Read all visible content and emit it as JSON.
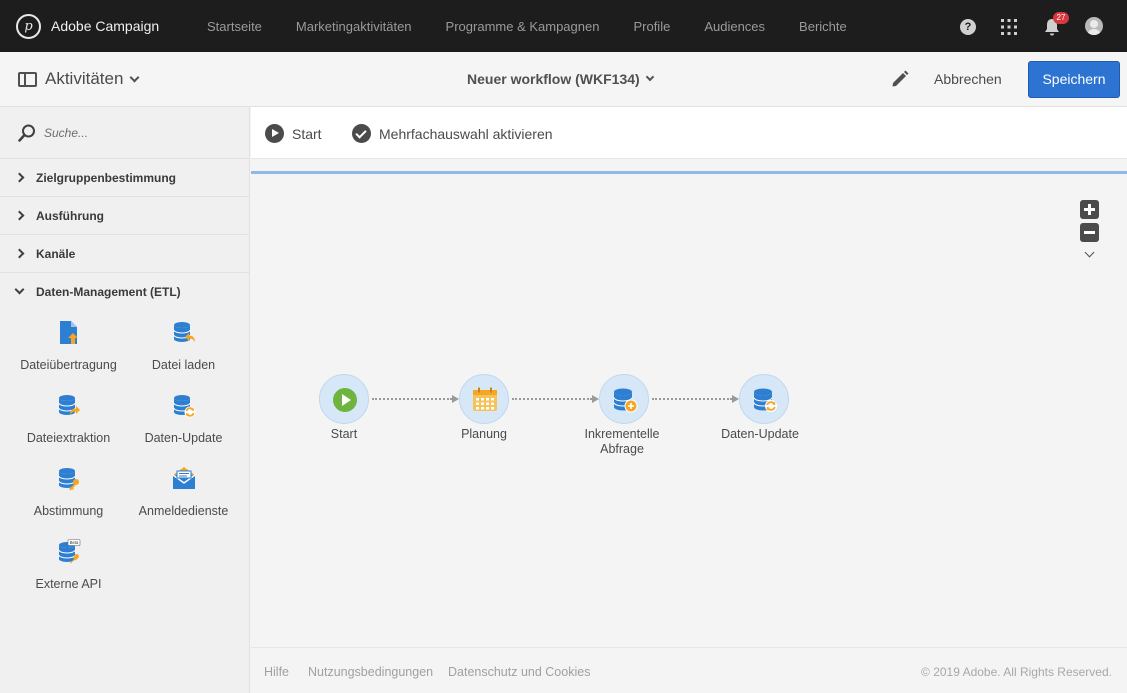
{
  "app": {
    "name": "Adobe Campaign",
    "logo_letter": "p"
  },
  "nav": {
    "items": [
      "Startseite",
      "Marketingaktivitäten",
      "Programme & Kampagnen",
      "Profile",
      "Audiences",
      "Berichte"
    ]
  },
  "topbar": {
    "help_glyph": "?",
    "notifications_count": "27"
  },
  "header": {
    "activities_label": "Aktivitäten",
    "workflow_title": "Neuer workflow (WKF134)",
    "cancel_label": "Abbrechen",
    "save_label": "Speichern"
  },
  "sidebar": {
    "search_placeholder": "Suche...",
    "categories": [
      {
        "label": "Zielgruppenbestimmung",
        "expanded": false
      },
      {
        "label": "Ausführung",
        "expanded": false
      },
      {
        "label": "Kanäle",
        "expanded": false
      },
      {
        "label": "Daten-Management (ETL)",
        "expanded": true
      }
    ],
    "activities": [
      {
        "label": "Dateiübertragung",
        "icon": "file-transfer-icon"
      },
      {
        "label": "Datei laden",
        "icon": "load-file-icon"
      },
      {
        "label": "Dateiextraktion",
        "icon": "extract-file-icon"
      },
      {
        "label": "Daten-Update",
        "icon": "update-data-icon"
      },
      {
        "label": "Abstimmung",
        "icon": "reconciliation-icon"
      },
      {
        "label": "Anmeldedienste",
        "icon": "subscription-services-icon"
      },
      {
        "label": "Externe API",
        "icon": "external-api-icon",
        "icon_text": "Beta"
      }
    ]
  },
  "toolbar": {
    "start_label": "Start",
    "multiselect_label": "Mehrfachauswahl aktivieren"
  },
  "workflow": {
    "nodes": [
      {
        "label": "Start",
        "icon": "start-play-icon"
      },
      {
        "label": "Planung",
        "icon": "calendar-icon"
      },
      {
        "label_line1": "Inkrementelle",
        "label_line2": "Abfrage",
        "icon": "incremental-query-icon"
      },
      {
        "label": "Daten-Update",
        "icon": "update-data-icon"
      }
    ]
  },
  "footer": {
    "help": "Hilfe",
    "terms": "Nutzungsbedingungen",
    "privacy": "Datenschutz und Cookies",
    "copyright": "© 2019 Adobe. All Rights Reserved."
  },
  "colors": {
    "topbar": "#1d1d1d",
    "primary_button": "#2d73d2",
    "node_bg": "#d6e7f7",
    "icon_blue": "#2e7fd1",
    "icon_orange": "#f6a623",
    "start_green": "#6fb43f",
    "badge_red": "#d7373f"
  }
}
